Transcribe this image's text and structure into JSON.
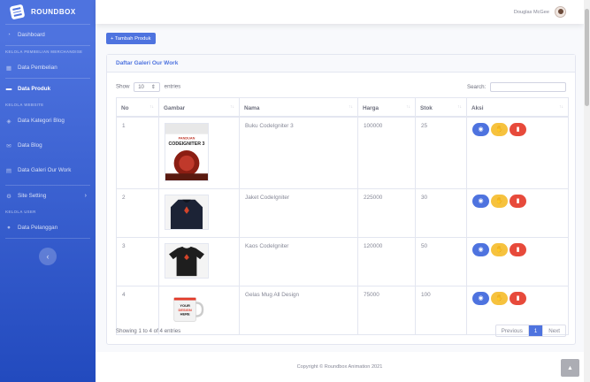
{
  "brand": {
    "name": "ROUNDBOX"
  },
  "sidebar": {
    "dashboard": "Dashboard",
    "heading1": "KELOLA PEMBELIAN MERCHANDISE",
    "pembelian": "Data Pembelian",
    "produk": "Data Produk",
    "heading2": "KELOLA WEBSITE",
    "kategori_blog": "Data Kategori Blog",
    "blog": "Data Blog",
    "galeri": "Data Galeri Our Work",
    "site_setting": "Site Setting",
    "heading3": "KELOLA USER",
    "pelanggan": "Data Pelanggan",
    "toggle_glyph": "‹"
  },
  "topbar": {
    "username": "Douglas McGee"
  },
  "page": {
    "add_button": "+ Tambah Produk"
  },
  "card": {
    "title": "Daftar Galeri Our Work",
    "show_label": "Show",
    "length_value": "10",
    "entries_label": "entries",
    "search_label": "Search:",
    "columns": [
      "No",
      "Gambar",
      "Nama",
      "Harga",
      "Stok",
      "Aksi"
    ],
    "rows": [
      {
        "no": "1",
        "nama": "Buku CodeIgniter 3",
        "harga": "100000",
        "stok": "25",
        "img": "book-cover"
      },
      {
        "no": "2",
        "nama": "Jaket CodeIgniter",
        "harga": "225000",
        "stok": "30",
        "img": "jacket"
      },
      {
        "no": "3",
        "nama": "Kaos CodeIgniter",
        "harga": "120000",
        "stok": "50",
        "img": "tshirt"
      },
      {
        "no": "4",
        "nama": "Gelas Mug All Design",
        "harga": "75000",
        "stok": "100",
        "img": "mug"
      }
    ],
    "book_text": {
      "top": "PANDUAN",
      "title": "CODEIGNITER 3"
    },
    "mug_text": {
      "line1": "YOUR",
      "line2": "DESIGN",
      "line3": "HERE"
    },
    "info": "Showing 1 to 4 of 4 entries",
    "pager": {
      "prev": "Previous",
      "current": "1",
      "next": "Next"
    }
  },
  "footer": {
    "copyright": "Copyright © Roundbox Animation 2021"
  },
  "colors": {
    "primary": "#4e73df",
    "warning": "#f6c23e",
    "danger": "#e74a3b"
  }
}
